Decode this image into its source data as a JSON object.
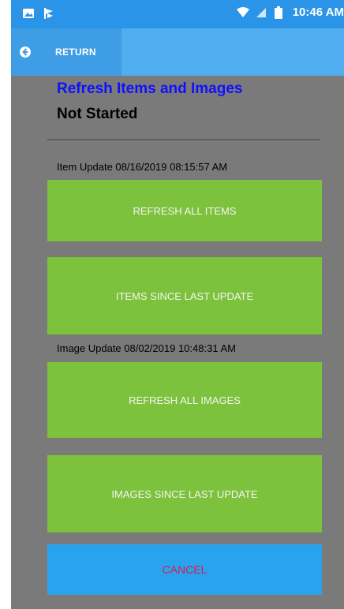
{
  "status_bar": {
    "time": "10:46 AM",
    "left_icons": [
      "image-icon",
      "flag-icon"
    ],
    "right_icons": [
      "wifi-icon",
      "signal-icon",
      "battery-icon"
    ]
  },
  "toolbar": {
    "return_label": "RETURN"
  },
  "content": {
    "title": "Refresh Items and Images",
    "status": "Not Started",
    "item_update_label": "Item Update 08/16/2019 08:15:57 AM",
    "image_update_label": "Image Update 08/02/2019 10:48:31 AM"
  },
  "buttons": {
    "refresh_all_items": "REFRESH ALL ITEMS",
    "items_since_last_update": "ITEMS SINCE LAST UPDATE",
    "refresh_all_images": "REFRESH ALL IMAGES",
    "images_since_last_update": "IMAGES SINCE LAST UPDATE",
    "cancel": "CANCEL"
  },
  "colors": {
    "status_bar": "#2a95e8",
    "toolbar": "#50aef0",
    "background": "#7a7a7a",
    "title": "#1010ff",
    "action_button": "#7cc23c",
    "cancel_button": "#2aa3ef",
    "cancel_text": "#d81b4a"
  }
}
